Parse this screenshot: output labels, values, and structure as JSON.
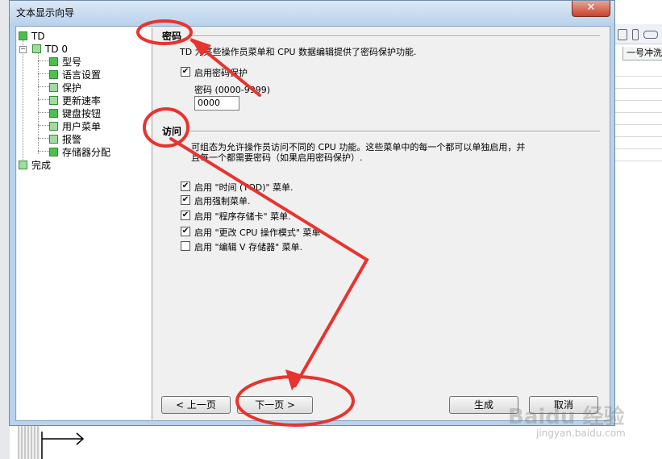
{
  "window": {
    "title": "文本显示向导",
    "close_glyph": "✕"
  },
  "background": {
    "tab_label": "一号冲洗"
  },
  "tree": {
    "items": [
      {
        "label": "TD",
        "checked": true
      },
      {
        "label": "TD 0",
        "checked": false
      },
      {
        "label": "型号",
        "checked": true
      },
      {
        "label": "语言设置",
        "checked": true
      },
      {
        "label": "保护",
        "checked": false
      },
      {
        "label": "更新速率",
        "checked": false
      },
      {
        "label": "键盘按钮",
        "checked": true
      },
      {
        "label": "用户菜单",
        "checked": false
      },
      {
        "label": "报警",
        "checked": false
      },
      {
        "label": "存储器分配",
        "checked": true
      },
      {
        "label": "完成",
        "checked": false
      }
    ],
    "expander_glyph": "−"
  },
  "password_section": {
    "title": "密码",
    "description": "TD 为某些操作员菜单和 CPU 数据编辑提供了密码保护功能.",
    "enable_label": "启用密码保护",
    "enable_checked": true,
    "password_label": "密码 (0000-9999)",
    "password_value": "0000"
  },
  "access_section": {
    "title": "访问",
    "description_line1": "可组态为允许操作员访问不同的 CPU 功能。这些菜单中的每一个都可以单独启用，并",
    "description_line2": "且每一个都需要密码（如果启用密码保护）.",
    "options": [
      {
        "label": "启用 \"时间 (TOD)\" 菜单.",
        "checked": true
      },
      {
        "label": "启用强制菜单.",
        "checked": true
      },
      {
        "label": "启用 \"程序存储卡\" 菜单.",
        "checked": true
      },
      {
        "label": "启用 \"更改 CPU 操作模式\" 菜单",
        "checked": true
      },
      {
        "label": "启用 \"编辑 V 存储器\" 菜单.",
        "checked": false
      }
    ]
  },
  "buttons": {
    "prev": "< 上一页",
    "next": "下一页 >",
    "generate": "生成",
    "cancel": "取消"
  },
  "check_glyph": "✔",
  "watermark": {
    "brand": "Baidu 经验",
    "url": "jingyan.baidu.com"
  },
  "annotation_color": "#e8332e"
}
